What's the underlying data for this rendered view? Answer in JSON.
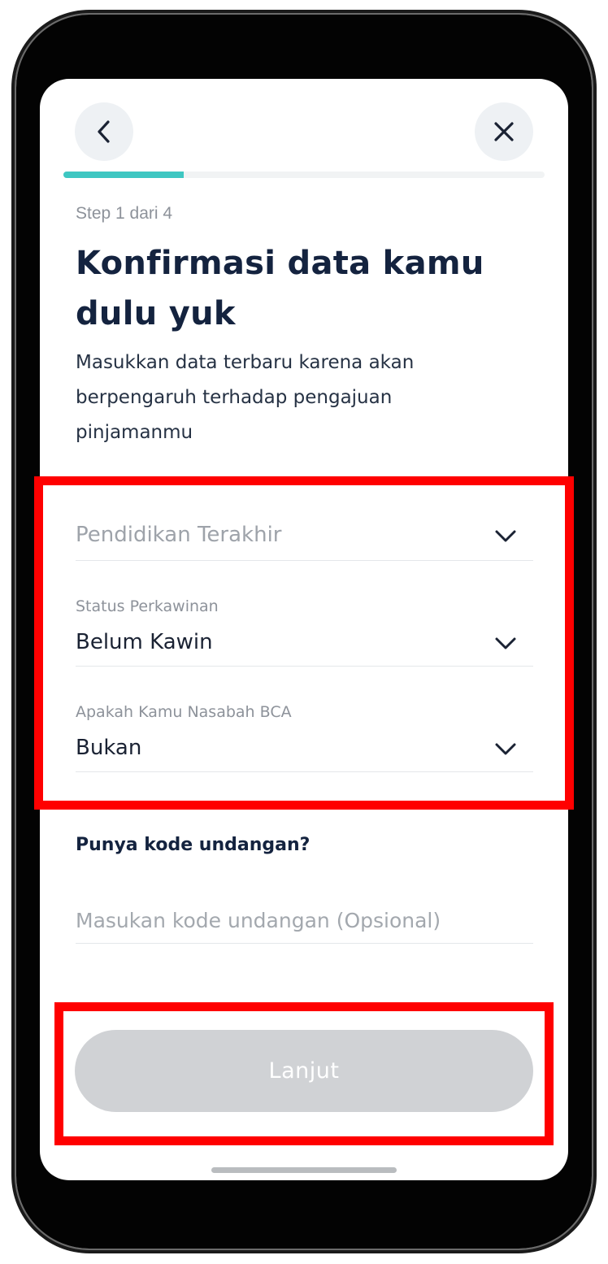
{
  "header": {
    "back_icon": "chevron-left-icon",
    "close_icon": "close-icon"
  },
  "progress": {
    "current_step": 1,
    "total_steps": 4,
    "fraction": 0.25,
    "color": "#3ec7c2"
  },
  "content": {
    "step_label": "Step 1 dari 4",
    "title": "Konfirmasi data kamu dulu yuk",
    "subtitle": "Masukkan data terbaru karena akan berpengaruh terhadap pengajuan pinjamanmu"
  },
  "form": {
    "education": {
      "placeholder": "Pendidikan Terakhir"
    },
    "marital_status": {
      "label": "Status Perkawinan",
      "value": "Belum Kawin"
    },
    "bca_customer": {
      "label": "Apakah Kamu Nasabah BCA",
      "value": "Bukan"
    },
    "invite_section_label": "Punya kode undangan?",
    "invite_placeholder": "Masukan kode undangan (Opsional)"
  },
  "cta": {
    "label": "Lanjut",
    "state": "disabled"
  },
  "colors": {
    "title": "#14233f",
    "annotation": "#ff0000",
    "cta_disabled": "#d0d2d5"
  }
}
